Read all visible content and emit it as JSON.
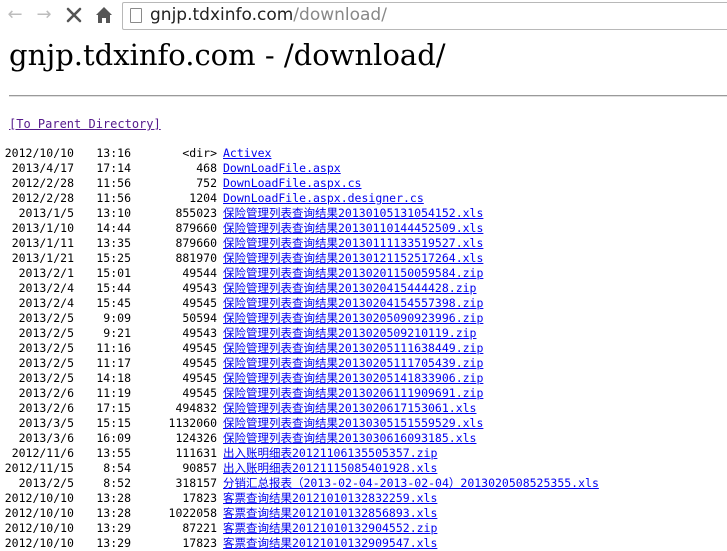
{
  "browser": {
    "url_host": "gnjp.tdxinfo.com",
    "url_path": "/download/"
  },
  "page": {
    "heading": "gnjp.tdxinfo.com - /download/",
    "parent_link": "[To Parent Directory]"
  },
  "rows": [
    {
      "date": "2012/10/10",
      "time": "13:16",
      "size": "<dir>",
      "name": "Activex"
    },
    {
      "date": "2013/4/17",
      "time": "17:14",
      "size": "468",
      "name": "DownLoadFile.aspx"
    },
    {
      "date": "2012/2/28",
      "time": "11:56",
      "size": "752",
      "name": "DownLoadFile.aspx.cs"
    },
    {
      "date": "2012/2/28",
      "time": "11:56",
      "size": "1204",
      "name": "DownLoadFile.aspx.designer.cs"
    },
    {
      "date": "2013/1/5",
      "time": "13:10",
      "size": "855023",
      "name": "保险管理列表查询结果20130105131054152.xls"
    },
    {
      "date": "2013/1/10",
      "time": "14:44",
      "size": "879660",
      "name": "保险管理列表查询结果20130110144452509.xls"
    },
    {
      "date": "2013/1/11",
      "time": "13:35",
      "size": "879660",
      "name": "保险管理列表查询结果20130111133519527.xls"
    },
    {
      "date": "2013/1/21",
      "time": "15:25",
      "size": "881970",
      "name": "保险管理列表查询结果20130121152517264.xls"
    },
    {
      "date": "2013/2/1",
      "time": "15:01",
      "size": "49544",
      "name": "保险管理列表查询结果20130201150059584.zip"
    },
    {
      "date": "2013/2/4",
      "time": "15:44",
      "size": "49543",
      "name": "保险管理列表查询结果2013020415444428.zip"
    },
    {
      "date": "2013/2/4",
      "time": "15:45",
      "size": "49545",
      "name": "保险管理列表查询结果20130204154557398.zip"
    },
    {
      "date": "2013/2/5",
      "time": "9:09",
      "size": "50594",
      "name": "保险管理列表查询结果20130205090923996.zip"
    },
    {
      "date": "2013/2/5",
      "time": "9:21",
      "size": "49543",
      "name": "保险管理列表查询结果2013020509210119.zip"
    },
    {
      "date": "2013/2/5",
      "time": "11:16",
      "size": "49545",
      "name": "保险管理列表查询结果20130205111638449.zip"
    },
    {
      "date": "2013/2/5",
      "time": "11:17",
      "size": "49545",
      "name": "保险管理列表查询结果20130205111705439.zip"
    },
    {
      "date": "2013/2/5",
      "time": "14:18",
      "size": "49545",
      "name": "保险管理列表查询结果20130205141833906.zip"
    },
    {
      "date": "2013/2/6",
      "time": "11:19",
      "size": "49545",
      "name": "保险管理列表查询结果20130206111909691.zip"
    },
    {
      "date": "2013/2/6",
      "time": "17:15",
      "size": "494832",
      "name": "保险管理列表查询结果2013020617153061.xls"
    },
    {
      "date": "2013/3/5",
      "time": "15:15",
      "size": "1132060",
      "name": "保险管理列表查询结果20130305151559529.xls"
    },
    {
      "date": "2013/3/6",
      "time": "16:09",
      "size": "124326",
      "name": "保险管理列表查询结果2013030616093185.xls"
    },
    {
      "date": "2012/11/6",
      "time": "13:55",
      "size": "111631",
      "name": "出入账明细表20121106135505357.zip"
    },
    {
      "date": "2012/11/15",
      "time": "8:54",
      "size": "90857",
      "name": "出入账明细表20121115085401928.xls"
    },
    {
      "date": "2013/2/5",
      "time": "8:52",
      "size": "318157",
      "name": "分销汇总报表（2013-02-04-2013-02-04）20130205085253​55.xls"
    },
    {
      "date": "2012/10/10",
      "time": "13:28",
      "size": "17823",
      "name": "客票查询结果20121010132832259.xls"
    },
    {
      "date": "2012/10/10",
      "time": "13:28",
      "size": "1022058",
      "name": "客票查询结果20121010132856893.xls"
    },
    {
      "date": "2012/10/10",
      "time": "13:29",
      "size": "87221",
      "name": "客票查询结果20121010132904552.zip"
    },
    {
      "date": "2012/10/10",
      "time": "13:29",
      "size": "17823",
      "name": "客票查询结果20121010132909547.xls"
    }
  ]
}
